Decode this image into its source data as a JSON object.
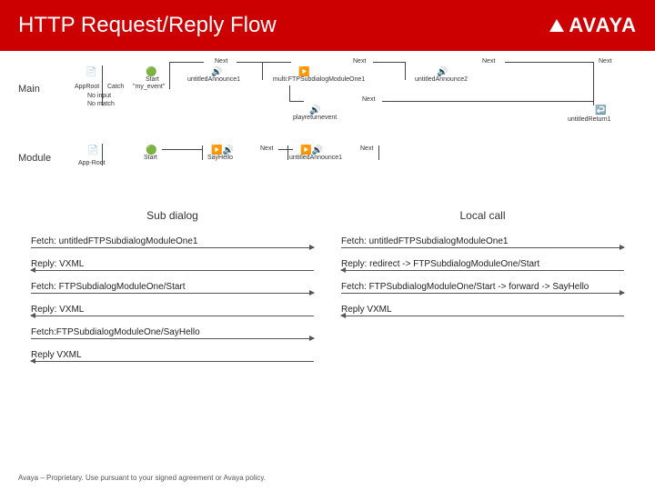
{
  "header": {
    "title": "HTTP Request/Reply Flow",
    "logo_text": "AVAYA"
  },
  "diagram": {
    "row1_label": "Main",
    "row2_label": "Module",
    "main_nodes": {
      "approot": "AppRoot",
      "catch": "Catch",
      "noinput": "No input",
      "nomatch": "No match",
      "start": "Start",
      "myevent": "\"my_event\"",
      "announce1": "untitledAnnounce1",
      "subdialog": "multi:FTPSubdialogModuleOne1",
      "playreturn": "playreturnevent",
      "announce2": "untitledAnnounce2",
      "return": "untitledReturn1",
      "next": "Next"
    },
    "module_nodes": {
      "approot": "App-Root",
      "start": "Start",
      "sayhello": "SayHello",
      "announce1": "untitledAnnounce1",
      "next": "Next"
    }
  },
  "comparison": {
    "left_title": "Sub dialog",
    "right_title": "Local call",
    "left_steps": [
      {
        "text": "Fetch: untitledFTPSubdialogModuleOne1",
        "dir": "right"
      },
      {
        "text": "Reply: VXML",
        "dir": "left"
      },
      {
        "text": "Fetch: FTPSubdialogModuleOne/Start",
        "dir": "right"
      },
      {
        "text": "Reply: VXML",
        "dir": "left"
      },
      {
        "text": "Fetch:FTPSubdialogModuleOne/SayHello",
        "dir": "right"
      },
      {
        "text": "Reply VXML",
        "dir": "left"
      }
    ],
    "right_steps": [
      {
        "text": "Fetch: untitledFTPSubdialogModuleOne1",
        "dir": "right"
      },
      {
        "text": "Reply: redirect -> FTPSubdialogModuleOne/Start",
        "dir": "left"
      },
      {
        "text": "Fetch: FTPSubdialogModuleOne/Start -> forward -> SayHello",
        "dir": "right"
      },
      {
        "text": "Reply VXML",
        "dir": "left"
      }
    ]
  },
  "footer": "Avaya – Proprietary. Use pursuant to your signed agreement or Avaya policy."
}
